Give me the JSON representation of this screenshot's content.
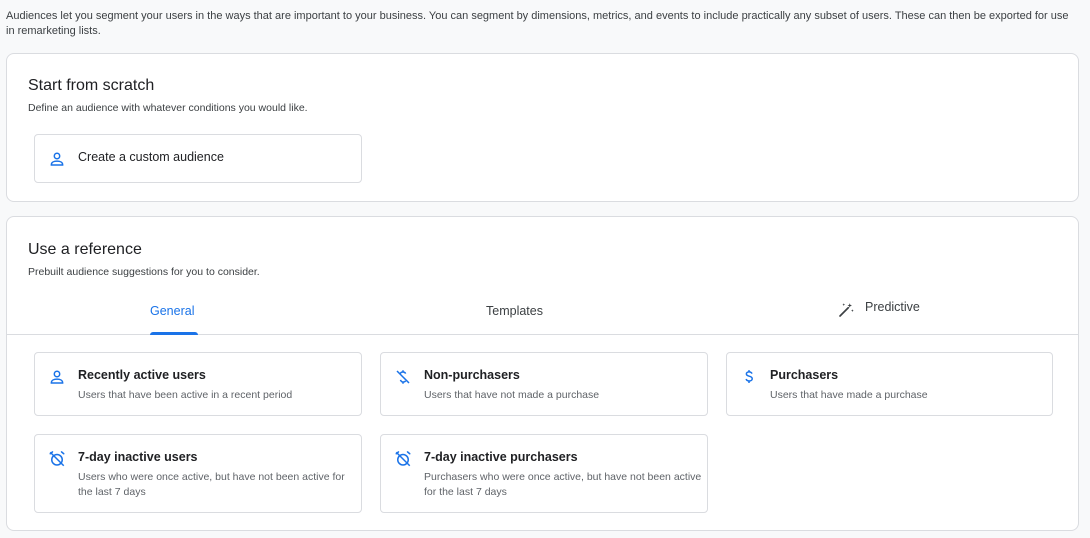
{
  "intro_text": "Audiences let you segment your users in the ways that are important to your business. You can segment by dimensions, metrics, and events to include practically any subset of users. These can then be exported for use in remarketing lists.",
  "scratch": {
    "title": "Start from scratch",
    "subtitle": "Define an audience with whatever conditions you would like.",
    "custom_label": "Create a custom audience"
  },
  "reference": {
    "title": "Use a reference",
    "subtitle": "Prebuilt audience suggestions for you to consider.",
    "tabs": [
      {
        "label": "General",
        "active": true
      },
      {
        "label": "Templates",
        "active": false
      },
      {
        "label": "Predictive",
        "active": false
      }
    ],
    "items": [
      {
        "name": "Recently active users",
        "desc": "Users that have been active in a recent period",
        "icon": "person-icon"
      },
      {
        "name": "Non-purchasers",
        "desc": "Users that have not made a purchase",
        "icon": "money-off-icon"
      },
      {
        "name": "Purchasers",
        "desc": "Users that have made a purchase",
        "icon": "dollar-icon"
      },
      {
        "name": "7-day inactive users",
        "desc": "Users who were once active, but have not been active for the last 7 days",
        "icon": "alarm-off-icon"
      },
      {
        "name": "7-day inactive purchasers",
        "desc": "Purchasers who were once active, but have not been active for the last 7 days",
        "icon": "alarm-off-icon"
      }
    ]
  },
  "colors": {
    "accent": "#1a73e8",
    "border": "#dadce0",
    "bg": "#f8f9fa"
  }
}
